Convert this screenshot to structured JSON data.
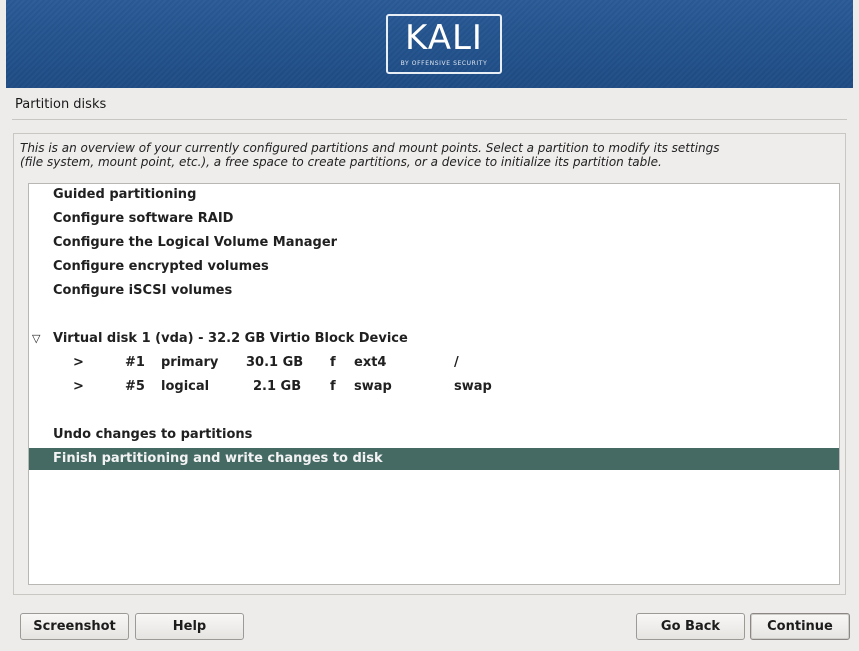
{
  "banner": {
    "logo_text": "KALI",
    "logo_subtext": "BY OFFENSIVE SECURITY"
  },
  "page": {
    "title": "Partition disks",
    "description_line1": "This is an overview of your currently configured partitions and mount points. Select a partition to modify its settings",
    "description_line2": "(file system, mount point, etc.), a free space to create partitions, or a device to initialize its partition table."
  },
  "options": {
    "guided": "Guided partitioning",
    "raid": "Configure software RAID",
    "lvm": "Configure the Logical Volume Manager",
    "encrypted": "Configure encrypted volumes",
    "iscsi": "Configure iSCSI volumes"
  },
  "disk": {
    "expander": "▽",
    "label": "Virtual disk 1 (vda) - 32.2 GB Virtio Block Device",
    "partitions": [
      {
        "arrow": ">",
        "num": "#1",
        "type": "primary",
        "size": "30.1 GB",
        "flag": "f",
        "fs": "ext4",
        "mount": "/"
      },
      {
        "arrow": ">",
        "num": "#5",
        "type": "logical",
        "size": "2.1 GB",
        "flag": "f",
        "fs": "swap",
        "mount": "swap"
      }
    ]
  },
  "actions": {
    "undo": "Undo changes to partitions",
    "finish": "Finish partitioning and write changes to disk"
  },
  "buttons": {
    "screenshot": "Screenshot",
    "help": "Help",
    "go_back": "Go Back",
    "continue": "Continue"
  },
  "colors": {
    "banner": "#23528c",
    "selection": "#456a64"
  }
}
